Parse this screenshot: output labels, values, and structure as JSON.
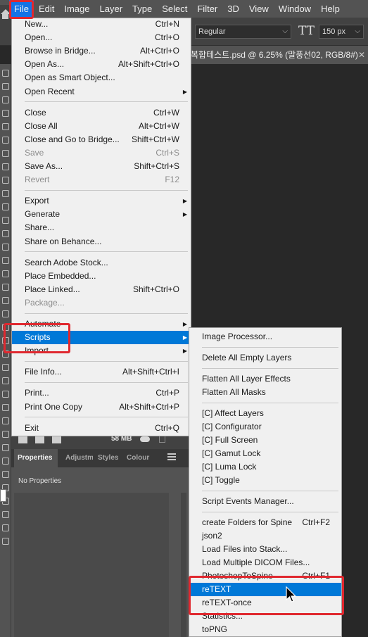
{
  "menubar": [
    "File",
    "Edit",
    "Image",
    "Layer",
    "Type",
    "Select",
    "Filter",
    "3D",
    "View",
    "Window",
    "Help"
  ],
  "options": {
    "font_style": "Regular",
    "font_size": "150 px"
  },
  "doc_tab": "복합테스트.psd @ 6.25% (말풍선02, RGB/8#)",
  "file_menu": [
    {
      "label": "New...",
      "shortcut": "Ctrl+N"
    },
    {
      "label": "Open...",
      "shortcut": "Ctrl+O"
    },
    {
      "label": "Browse in Bridge...",
      "shortcut": "Alt+Ctrl+O"
    },
    {
      "label": "Open As...",
      "shortcut": "Alt+Shift+Ctrl+O"
    },
    {
      "label": "Open as Smart Object..."
    },
    {
      "label": "Open Recent",
      "submenu": true
    },
    {
      "separator": true
    },
    {
      "label": "Close",
      "shortcut": "Ctrl+W"
    },
    {
      "label": "Close All",
      "shortcut": "Alt+Ctrl+W"
    },
    {
      "label": "Close and Go to Bridge...",
      "shortcut": "Shift+Ctrl+W"
    },
    {
      "label": "Save",
      "shortcut": "Ctrl+S",
      "disabled": true
    },
    {
      "label": "Save As...",
      "shortcut": "Shift+Ctrl+S"
    },
    {
      "label": "Revert",
      "shortcut": "F12",
      "disabled": true
    },
    {
      "separator": true
    },
    {
      "label": "Export",
      "submenu": true
    },
    {
      "label": "Generate",
      "submenu": true
    },
    {
      "label": "Share..."
    },
    {
      "label": "Share on Behance..."
    },
    {
      "separator": true
    },
    {
      "label": "Search Adobe Stock..."
    },
    {
      "label": "Place Embedded..."
    },
    {
      "label": "Place Linked...",
      "shortcut": "Shift+Ctrl+O"
    },
    {
      "label": "Package...",
      "disabled": true
    },
    {
      "separator": true
    },
    {
      "label": "Automate",
      "submenu": true
    },
    {
      "label": "Scripts",
      "submenu": true,
      "highlighted": true
    },
    {
      "label": "Import",
      "submenu": true
    },
    {
      "separator": true
    },
    {
      "label": "File Info...",
      "shortcut": "Alt+Shift+Ctrl+I"
    },
    {
      "separator": true
    },
    {
      "label": "Print...",
      "shortcut": "Ctrl+P"
    },
    {
      "label": "Print One Copy",
      "shortcut": "Alt+Shift+Ctrl+P"
    },
    {
      "separator": true
    },
    {
      "label": "Exit",
      "shortcut": "Ctrl+Q"
    }
  ],
  "scripts_menu": [
    {
      "label": "Image Processor..."
    },
    {
      "separator": true
    },
    {
      "label": "Delete All Empty Layers"
    },
    {
      "separator": true
    },
    {
      "label": "Flatten All Layer Effects"
    },
    {
      "label": "Flatten All Masks"
    },
    {
      "separator": true
    },
    {
      "label": "[C] Affect Layers"
    },
    {
      "label": "[C] Configurator"
    },
    {
      "label": "[C] Full Screen"
    },
    {
      "label": "[C] Gamut Lock"
    },
    {
      "label": "[C] Luma Lock"
    },
    {
      "label": "[C] Toggle"
    },
    {
      "separator": true
    },
    {
      "label": "Script Events Manager..."
    },
    {
      "separator": true
    },
    {
      "label": "create Folders for Spine",
      "shortcut": "Ctrl+F2"
    },
    {
      "label": "json2"
    },
    {
      "label": "Load Files into Stack..."
    },
    {
      "label": "Load Multiple DICOM Files..."
    },
    {
      "label": "PhotoshopToSpine",
      "shortcut": "Ctrl+F1"
    },
    {
      "label": "reTEXT",
      "highlighted": true
    },
    {
      "label": "reTEXT-once"
    },
    {
      "label": "Statistics..."
    },
    {
      "label": "toPNG"
    }
  ],
  "layers_panel": {
    "memory": "58 MB"
  },
  "properties_panel": {
    "tabs": [
      "Properties",
      "Adjustm",
      "Styles",
      "Colour"
    ],
    "message": "No Properties"
  },
  "colors": {
    "highlight": "#0078d7",
    "annotation": "#e0282f"
  }
}
